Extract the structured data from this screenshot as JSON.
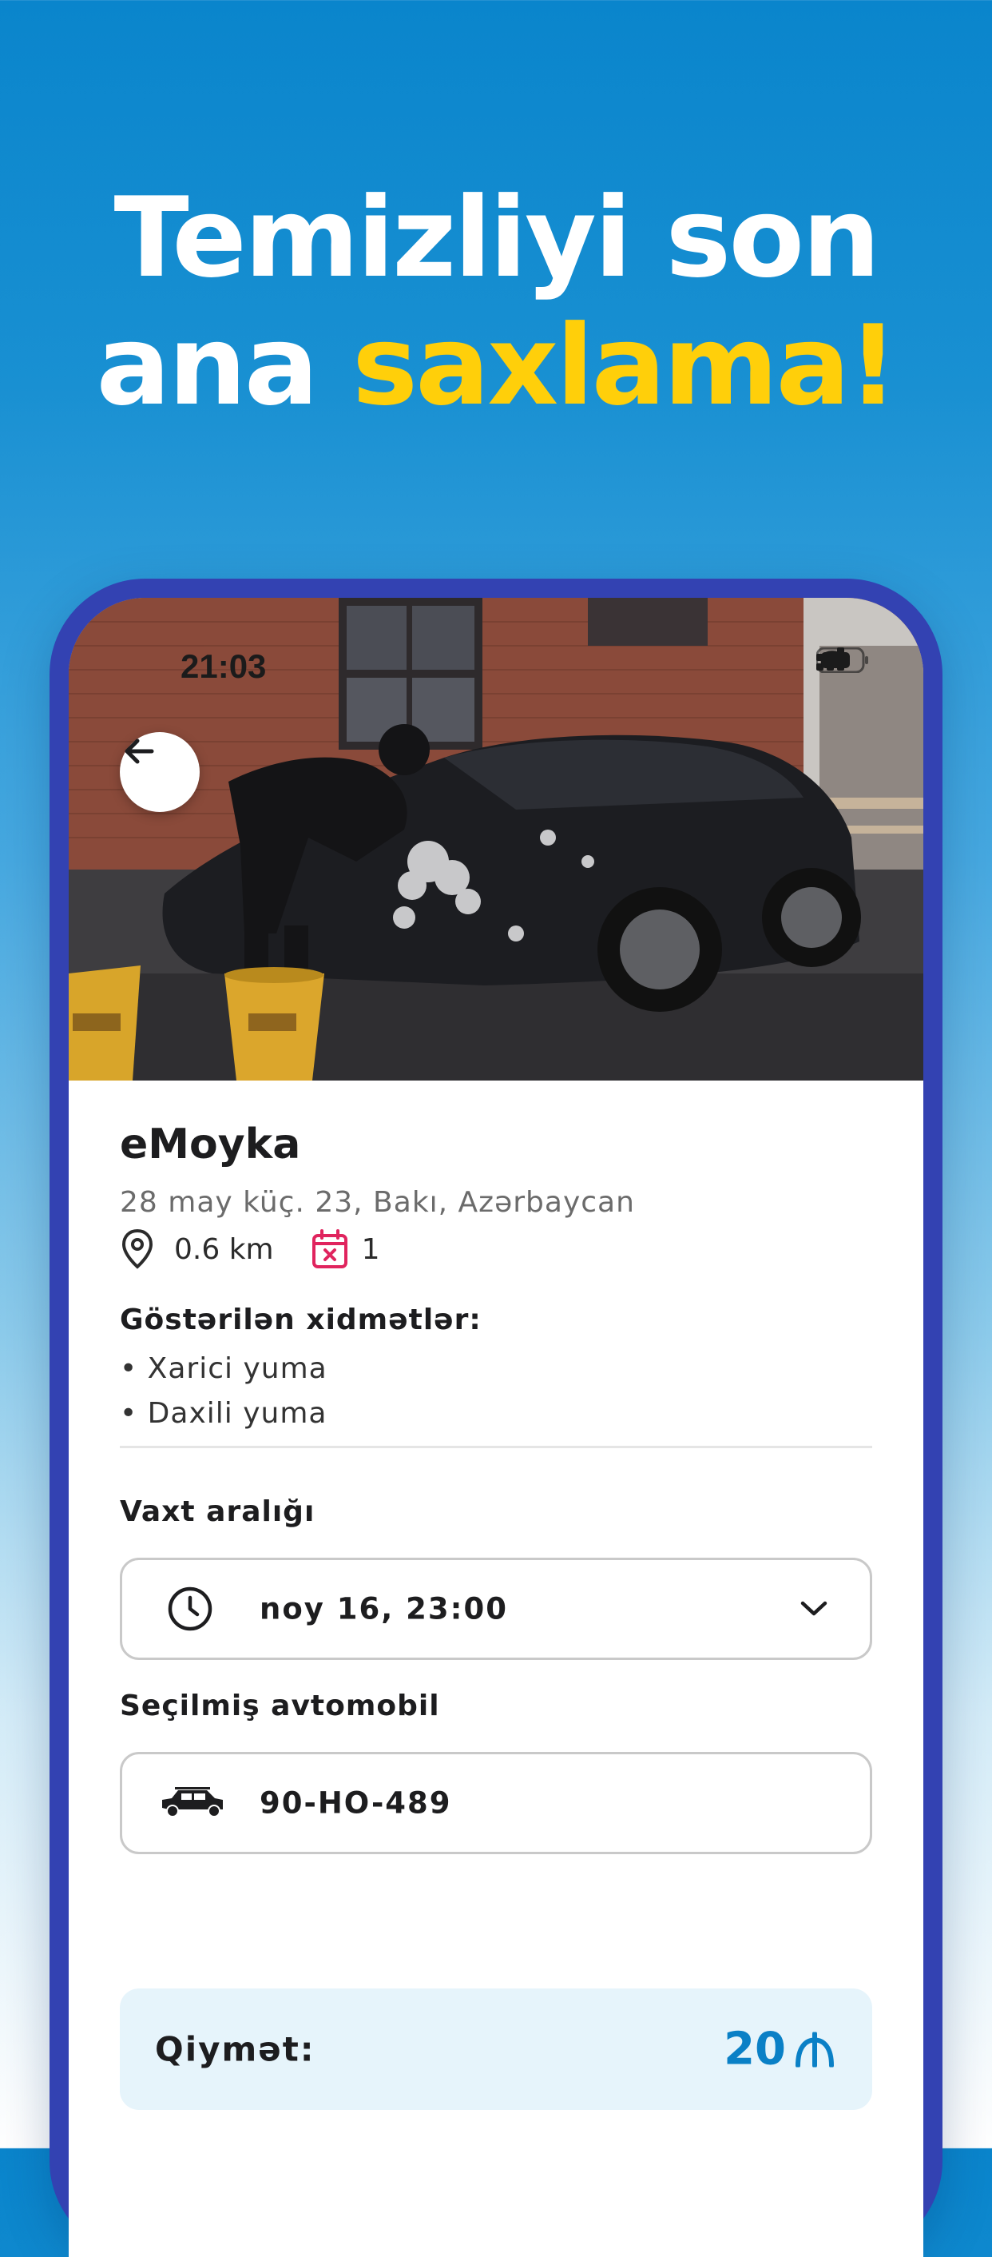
{
  "promo": {
    "headline_line1": "Temizliyi son",
    "headline_line2_prefix": "ana ",
    "headline_line2_accent": "saxlama!",
    "accent_color": "#ffcf0a",
    "background_color": "#0a85cc"
  },
  "status_bar": {
    "time": "21:03",
    "icons": [
      "cellular-signal-icon",
      "wifi-icon",
      "battery-icon"
    ]
  },
  "nav": {
    "back_icon": "arrow-left-icon"
  },
  "place": {
    "name": "eMoyka",
    "address": "28 may küç. 23, Bakı, Azərbaycan",
    "distance": "0.6 km",
    "calendar_count": "1",
    "services_label": "Göstərilən xidmətlər:",
    "services": [
      "• Xarici yuma",
      "• Daxili yuma"
    ]
  },
  "booking": {
    "time_label": "Vaxt aralığı",
    "time_value": "noy 16, 23:00",
    "car_label": "Seçilmiş avtomobil",
    "car_value": "90-HO-489"
  },
  "price": {
    "label": "Qiymət:",
    "value": "20",
    "currency_icon": "manat-icon",
    "accent_color": "#0a80c6"
  }
}
